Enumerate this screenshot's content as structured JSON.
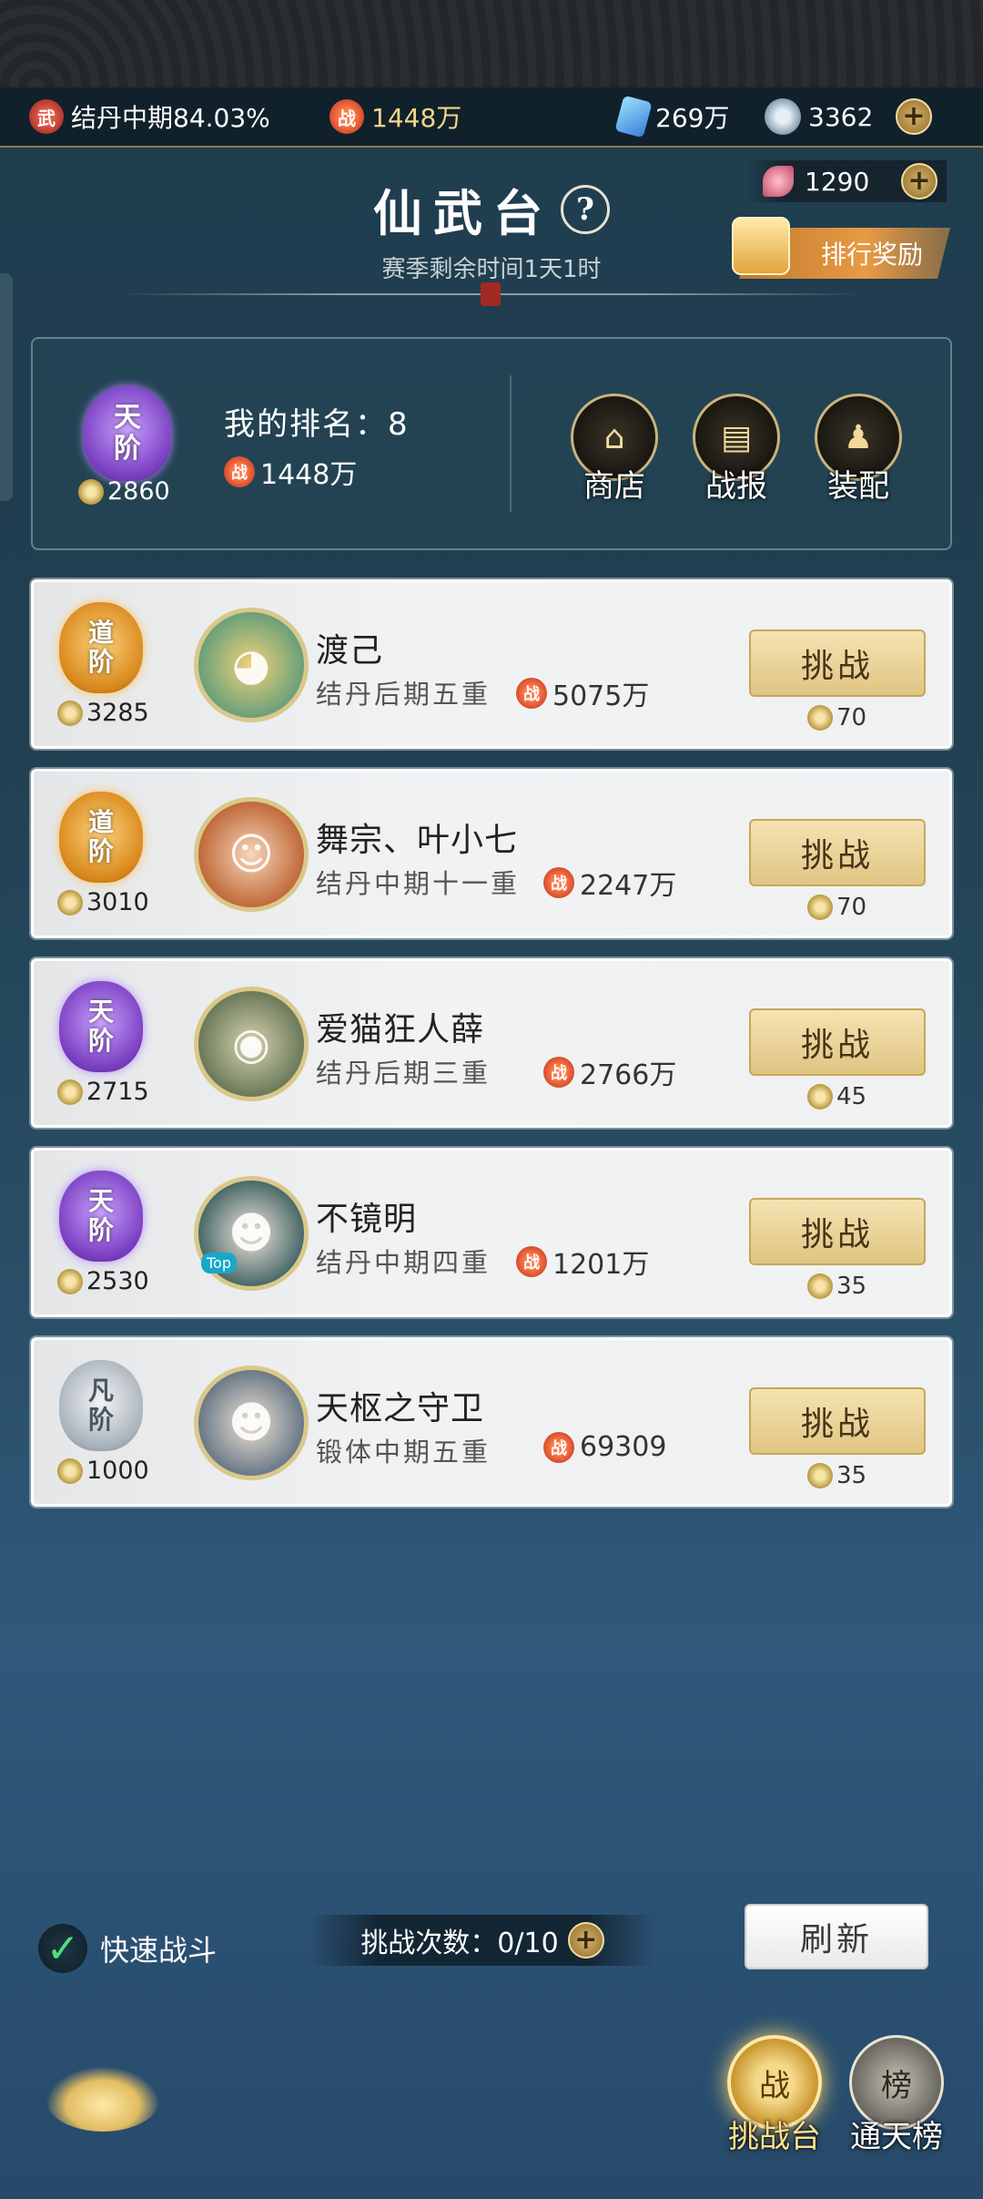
{
  "resources": {
    "cultivation": "结丹中期84.03%",
    "cultivation_icon": "武",
    "power": "1448万",
    "power_icon": "战",
    "spirit_stone": "269万",
    "jade_coin": "3362",
    "flower": "1290"
  },
  "header": {
    "title": "仙武台",
    "help": "?",
    "season_remaining": "赛季剩余时间1天1时",
    "rank_reward": "排行奖励"
  },
  "my_info": {
    "tier_top": "天",
    "tier_bottom": "阶",
    "score": "2860",
    "rank_text": "我的排名：8",
    "power": "1448万",
    "buttons": [
      "商店",
      "战报",
      "装配"
    ]
  },
  "opponents": [
    {
      "tier_top": "道",
      "tier_bottom": "阶",
      "tier": "dao",
      "score": "3285",
      "name": "渡己",
      "realm": "结丹后期五重",
      "power": "5075万",
      "challenge": "挑战",
      "cost": "70"
    },
    {
      "tier_top": "道",
      "tier_bottom": "阶",
      "tier": "dao",
      "score": "3010",
      "name": "舞宗、叶小七",
      "realm": "结丹中期十一重",
      "power": "2247万",
      "challenge": "挑战",
      "cost": "70"
    },
    {
      "tier_top": "天",
      "tier_bottom": "阶",
      "tier": "tian",
      "score": "2715",
      "name": "爱猫狂人薛",
      "realm": "结丹后期三重",
      "power": "2766万",
      "challenge": "挑战",
      "cost": "45"
    },
    {
      "tier_top": "天",
      "tier_bottom": "阶",
      "tier": "tian",
      "score": "2530",
      "name": "不镜明",
      "realm": "结丹中期四重",
      "power": "1201万",
      "challenge": "挑战",
      "cost": "35",
      "avatar_badge": "Top"
    },
    {
      "tier_top": "凡",
      "tier_bottom": "阶",
      "tier": "fan",
      "score": "1000",
      "name": "天枢之守卫",
      "realm": "锻体中期五重",
      "power": "69309",
      "challenge": "挑战",
      "cost": "35"
    }
  ],
  "footer": {
    "quick_fight": "快速战斗",
    "quick_fight_checked": true,
    "attempts_text": "挑战次数：0/10",
    "refresh": "刷新"
  },
  "nav": {
    "arena": "挑战台",
    "arena_icon": "战",
    "ladder": "通天榜",
    "ladder_icon": "榜"
  },
  "colors": {
    "accent_gold": "#f6d58a",
    "power_red": "#b82d18",
    "tier_tian": "#7a3ec0",
    "tier_dao": "#d8881c",
    "tier_fan": "#a9b2ba"
  }
}
